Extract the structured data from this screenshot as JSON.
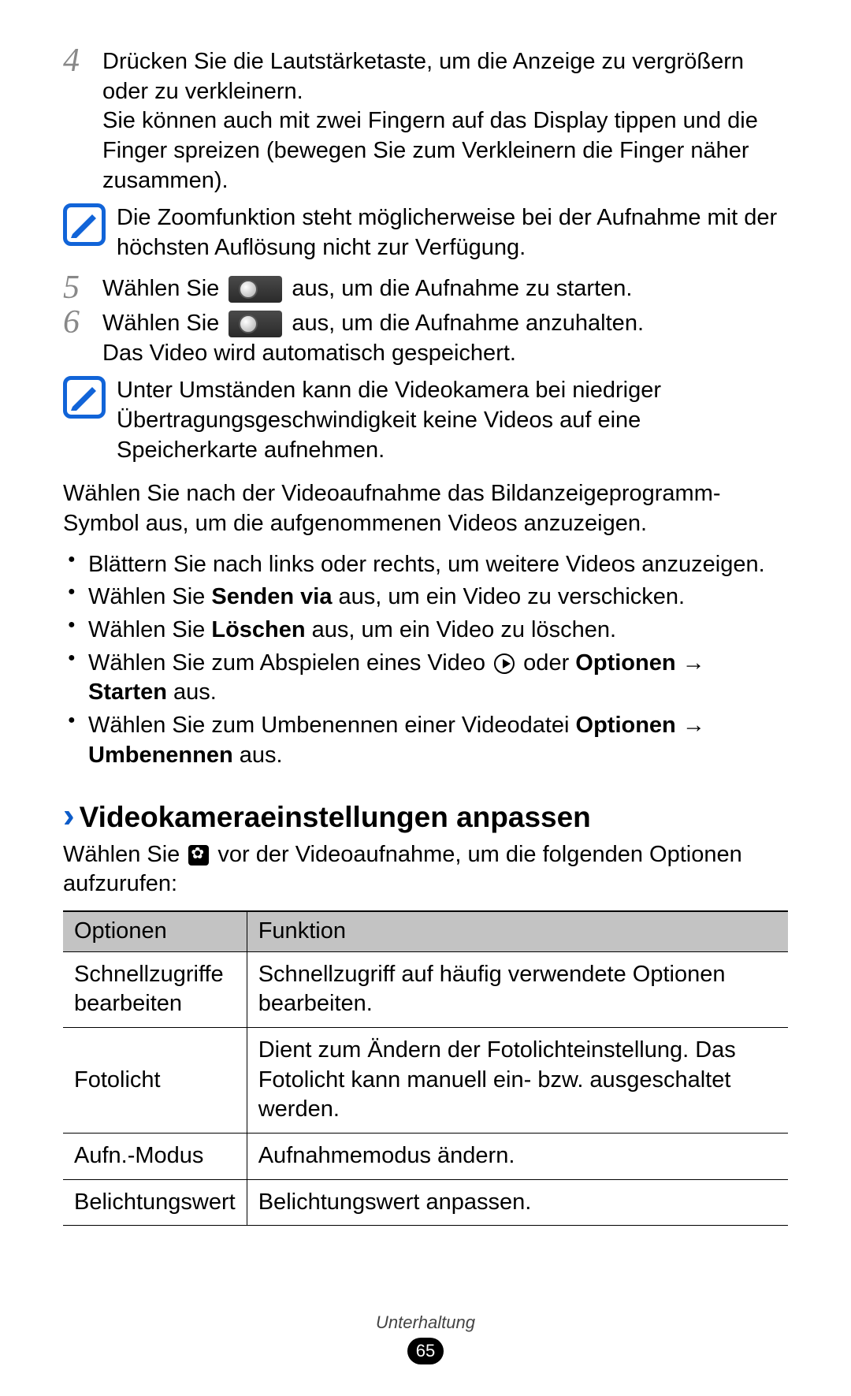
{
  "steps": {
    "s4": {
      "num": "4",
      "p1": "Drücken Sie die Lautstärketaste, um die Anzeige zu vergrößern oder zu verkleinern.",
      "p2": "Sie können auch mit zwei Fingern auf das Display tippen und die Finger spreizen (bewegen Sie zum Verkleinern die Finger näher zusammen)."
    },
    "s5": {
      "num": "5",
      "pre": "Wählen Sie ",
      "post": " aus, um die Aufnahme zu starten."
    },
    "s6": {
      "num": "6",
      "pre": "Wählen Sie ",
      "post": " aus, um die Aufnahme anzuhalten.",
      "extra": "Das Video wird automatisch gespeichert."
    }
  },
  "notes": {
    "n1": "Die Zoomfunktion steht möglicherweise bei der Aufnahme mit der höchsten Auflösung nicht zur Verfügung.",
    "n2": "Unter Umständen kann die Videokamera bei niedriger Übertragungsgeschwindigkeit keine Videos auf eine Speicherkarte aufnehmen."
  },
  "afterPara": "Wählen Sie nach der Videoaufnahme das Bildanzeigeprogramm-Symbol aus, um die aufgenommenen Videos anzuzeigen.",
  "bullets": {
    "b1": "Blättern Sie nach links oder rechts, um weitere Videos anzuzeigen.",
    "b2_pre": "Wählen Sie ",
    "b2_bold": "Senden via",
    "b2_post": " aus, um ein Video zu verschicken.",
    "b3_pre": "Wählen Sie ",
    "b3_bold": "Löschen",
    "b3_post": " aus, um ein Video zu löschen.",
    "b4_pre": "Wählen Sie zum Abspielen eines Video ",
    "b4_mid": " oder ",
    "b4_bold1": "Optionen",
    "b4_arrow": " → ",
    "b4_bold2": "Starten",
    "b4_post": " aus.",
    "b5_pre": "Wählen Sie zum Umbenennen einer Videodatei ",
    "b5_bold1": "Optionen",
    "b5_arrow": " → ",
    "b5_bold2": "Umbenennen",
    "b5_post": " aus."
  },
  "section": {
    "title": "Videokameraeinstellungen anpassen",
    "intro_pre": "Wählen Sie ",
    "intro_post": " vor der Videoaufnahme, um die folgenden Optionen aufzurufen:"
  },
  "table": {
    "h1": "Optionen",
    "h2": "Funktion",
    "rows": [
      {
        "opt": "Schnellzugriffe bearbeiten",
        "func": "Schnellzugriff auf häufig verwendete Optionen bearbeiten."
      },
      {
        "opt": "Fotolicht",
        "func": "Dient zum Ändern der Fotolichteinstellung. Das Fotolicht kann manuell ein- bzw. ausgeschaltet werden."
      },
      {
        "opt": "Aufn.-Modus",
        "func": "Aufnahmemodus ändern."
      },
      {
        "opt": "Belichtungswert",
        "func": "Belichtungswert anpassen."
      }
    ]
  },
  "footer": {
    "section": "Unterhaltung",
    "page": "65"
  }
}
